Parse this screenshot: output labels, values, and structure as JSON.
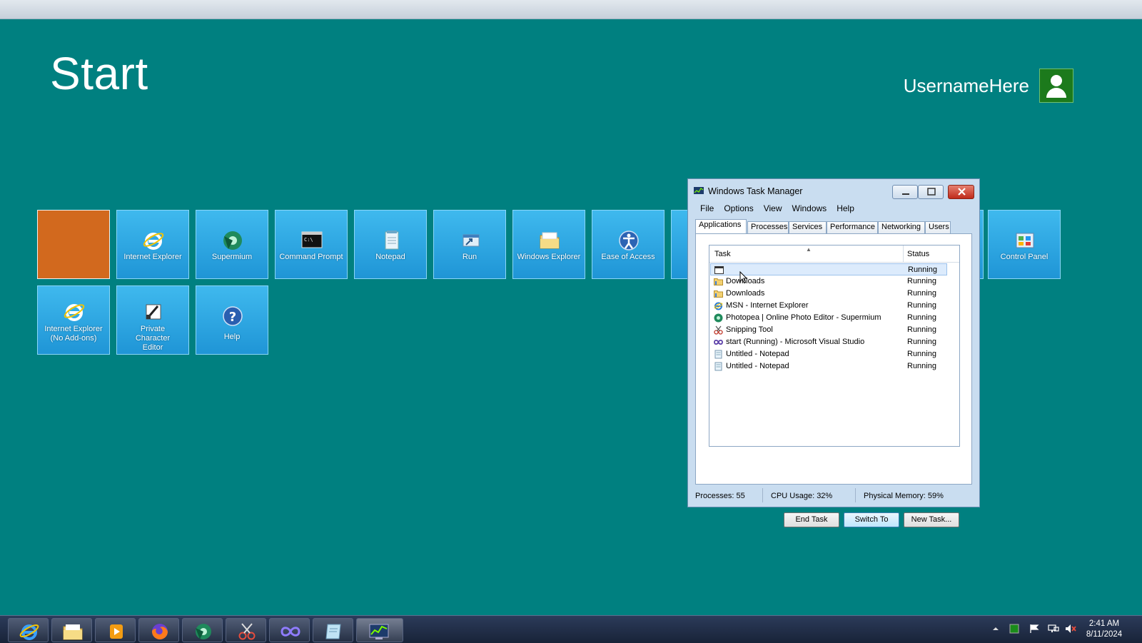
{
  "start": {
    "title": "Start",
    "username": "UsernameHere"
  },
  "tiles": [
    {
      "label": ""
    },
    {
      "label": "Internet Explorer"
    },
    {
      "label": "Supermium"
    },
    {
      "label": "Command Prompt"
    },
    {
      "label": "Notepad"
    },
    {
      "label": "Run"
    },
    {
      "label": "Windows Explorer"
    },
    {
      "label": "Ease of Access"
    },
    {
      "label": "Control Panel"
    },
    {
      "label": "Internet Explorer (No Add-ons)"
    },
    {
      "label": "Private Character Editor"
    },
    {
      "label": "Help"
    }
  ],
  "taskmgr": {
    "title": "Windows Task Manager",
    "menu": [
      "File",
      "Options",
      "View",
      "Windows",
      "Help"
    ],
    "tabs": [
      "Applications",
      "Processes",
      "Services",
      "Performance",
      "Networking",
      "Users"
    ],
    "columns": {
      "task": "Task",
      "status": "Status"
    },
    "rows": [
      {
        "task": "",
        "status": "Running"
      },
      {
        "task": "Downloads",
        "status": "Running"
      },
      {
        "task": "Downloads",
        "status": "Running"
      },
      {
        "task": "MSN - Internet Explorer",
        "status": "Running"
      },
      {
        "task": "Photopea | Online Photo Editor - Supermium",
        "status": "Running"
      },
      {
        "task": "Snipping Tool",
        "status": "Running"
      },
      {
        "task": "start (Running) - Microsoft Visual Studio",
        "status": "Running"
      },
      {
        "task": "Untitled - Notepad",
        "status": "Running"
      },
      {
        "task": "Untitled - Notepad",
        "status": "Running"
      }
    ],
    "buttons": {
      "end_task": "End Task",
      "switch_to": "Switch To",
      "new_task": "New Task..."
    },
    "status": {
      "processes": "Processes: 55",
      "cpu": "CPU Usage: 32%",
      "memory": "Physical Memory: 59%"
    }
  },
  "taskbar": {
    "time": "2:41 AM",
    "date": "8/11/2024"
  }
}
